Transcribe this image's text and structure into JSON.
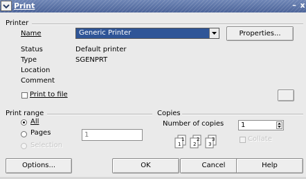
{
  "window": {
    "title": "Print",
    "minimize_glyph": "–",
    "close_glyph": "x"
  },
  "printer": {
    "group_label": "Printer",
    "name_label": "Name",
    "name_value": "Generic Printer",
    "properties_label": "Properties...",
    "status_label": "Status",
    "status_value": "Default printer",
    "type_label": "Type",
    "type_value": "SGENPRT",
    "location_label": "Location",
    "comment_label": "Comment",
    "print_to_file_label": "Print to file",
    "print_to_file_checked": false
  },
  "print_range": {
    "group_label": "Print range",
    "all_label": "All",
    "pages_label": "Pages",
    "pages_value": "1",
    "selection_label": "Selection",
    "selected": "all"
  },
  "copies": {
    "group_label": "Copies",
    "number_label": "Number of copies",
    "number_value": "1",
    "collate_label": "Collate",
    "collate_enabled": false
  },
  "buttons": {
    "options": "Options...",
    "ok": "OK",
    "cancel": "Cancel",
    "help": "Help"
  },
  "colors": {
    "title_bar": "#5a72a7",
    "selected_field": "#2f5597",
    "dialog_background": "#eaeaea"
  },
  "icons": {
    "window_menu": "checkmark-dropdown-icon",
    "combo": "triangle-down-icon",
    "collate": "collate-pages-icon"
  }
}
